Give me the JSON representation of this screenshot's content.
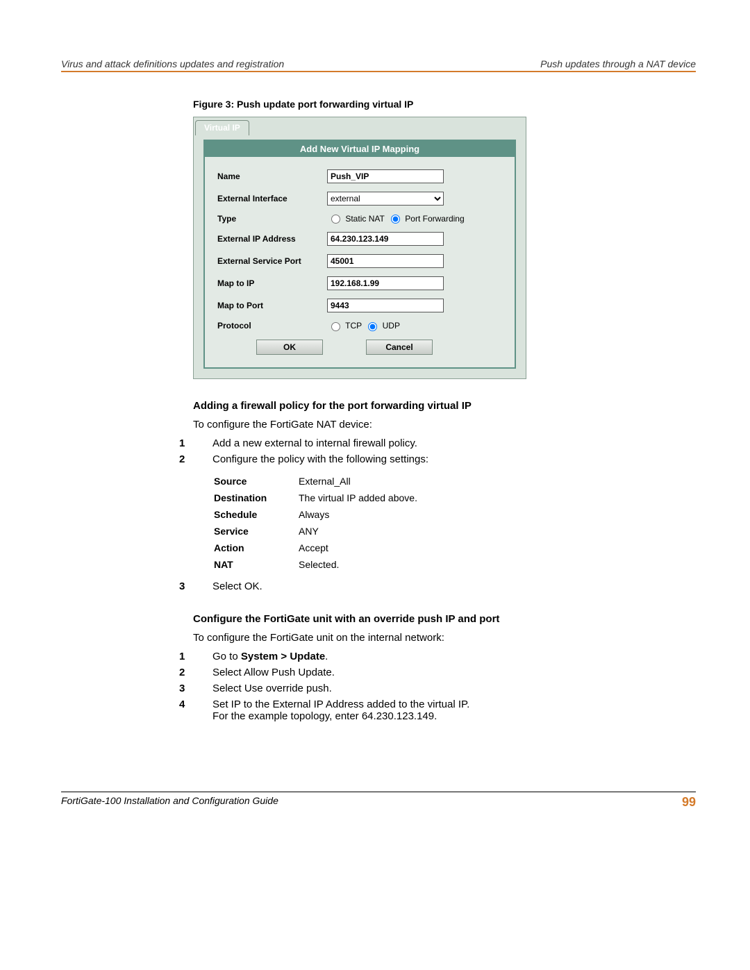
{
  "header": {
    "left": "Virus and attack definitions updates and registration",
    "right": "Push updates through a NAT device"
  },
  "figure_caption": "Figure 3:   Push update port forwarding virtual IP",
  "vip": {
    "tab": "Virtual IP",
    "panel_title": "Add New Virtual IP Mapping",
    "labels": {
      "name": "Name",
      "ext_if": "External Interface",
      "type": "Type",
      "ext_ip": "External IP Address",
      "ext_port": "External Service Port",
      "map_ip": "Map to IP",
      "map_port": "Map to Port",
      "protocol": "Protocol"
    },
    "values": {
      "name": "Push_VIP",
      "ext_if": "external",
      "ext_ip": "64.230.123.149",
      "ext_port": "45001",
      "map_ip": "192.168.1.99",
      "map_port": "9443"
    },
    "type_options": {
      "static": "Static NAT",
      "pf": "Port Forwarding"
    },
    "proto_options": {
      "tcp": "TCP",
      "udp": "UDP"
    },
    "buttons": {
      "ok": "OK",
      "cancel": "Cancel"
    }
  },
  "section1_heading": "Adding a firewall policy for the port forwarding virtual IP",
  "section1_intro": "To configure the FortiGate NAT device:",
  "steps1": {
    "1": "Add a new external to internal firewall policy.",
    "2": "Configure the policy with the following settings:",
    "3": "Select OK."
  },
  "settings": [
    {
      "k": "Source",
      "v": "External_All"
    },
    {
      "k": "Destination",
      "v": "The virtual IP added above."
    },
    {
      "k": "Schedule",
      "v": "Always"
    },
    {
      "k": "Service",
      "v": "ANY"
    },
    {
      "k": "Action",
      "v": "Accept"
    },
    {
      "k": "NAT",
      "v": "Selected."
    }
  ],
  "section2_heading": "Configure the FortiGate unit with an override push IP and port",
  "section2_intro": "To configure the FortiGate unit on the internal network:",
  "steps2": {
    "1_pre": "Go to ",
    "1_bold": "System > Update",
    "1_post": ".",
    "2": "Select Allow Push Update.",
    "3": "Select Use override push.",
    "4a": "Set IP to the External IP Address added to the virtual IP.",
    "4b": "For the example topology, enter 64.230.123.149."
  },
  "footer": {
    "left": "FortiGate-100 Installation and Configuration Guide",
    "right": "99"
  }
}
